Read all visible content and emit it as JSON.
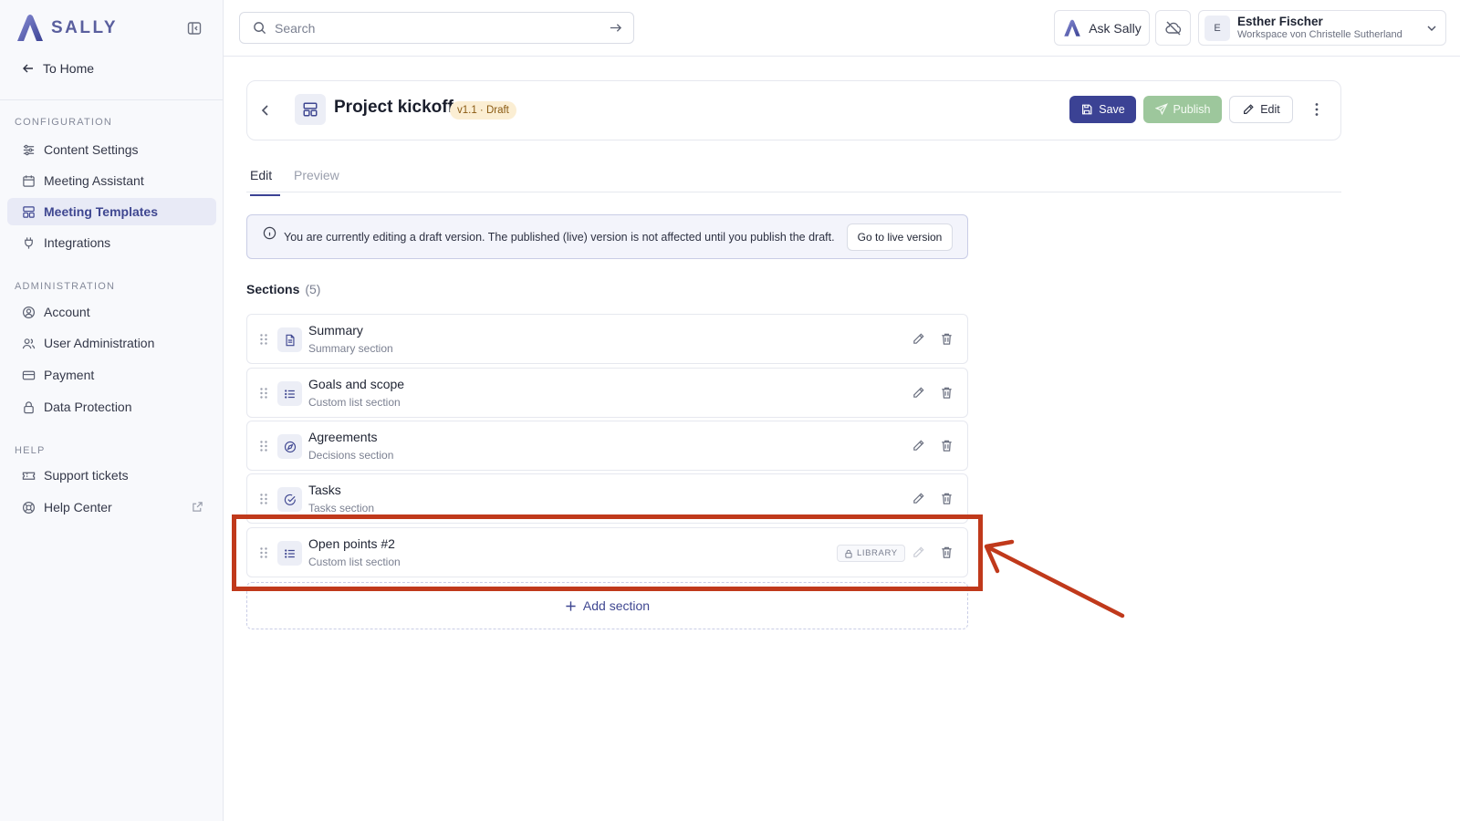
{
  "app": {
    "brand": "SALLY",
    "brand_color": "#5a5f9e",
    "accent_color": "#3b4294"
  },
  "sidebar": {
    "to_home": "To Home",
    "sections": [
      {
        "title": "CONFIGURATION",
        "items": [
          {
            "label": "Content Settings",
            "icon": "sliders-icon",
            "active": false
          },
          {
            "label": "Meeting Assistant",
            "icon": "calendar-icon",
            "active": false
          },
          {
            "label": "Meeting Templates",
            "icon": "layout-template-icon",
            "active": true
          },
          {
            "label": "Integrations",
            "icon": "plug-icon",
            "active": false
          }
        ]
      },
      {
        "title": "ADMINISTRATION",
        "items": [
          {
            "label": "Account",
            "icon": "user-circle-icon",
            "active": false
          },
          {
            "label": "User Administration",
            "icon": "users-icon",
            "active": false
          },
          {
            "label": "Payment",
            "icon": "credit-card-icon",
            "active": false
          },
          {
            "label": "Data Protection",
            "icon": "lock-icon",
            "active": false
          }
        ]
      },
      {
        "title": "HELP",
        "items": [
          {
            "label": "Support tickets",
            "icon": "ticket-icon",
            "active": false
          },
          {
            "label": "Help Center",
            "icon": "lifebuoy-icon",
            "active": false,
            "external": true
          }
        ]
      }
    ]
  },
  "topbar": {
    "search_placeholder": "Search",
    "ask_sally": "Ask Sally",
    "user": {
      "initial": "E",
      "name": "Esther Fischer",
      "workspace": "Workspace von Christelle Sutherland"
    }
  },
  "template": {
    "title": "Project kickoff",
    "badge": "v1.1 · Draft",
    "buttons": {
      "save": "Save",
      "publish": "Publish",
      "edit": "Edit"
    }
  },
  "tabs": {
    "edit": "Edit",
    "preview": "Preview",
    "active": "Edit"
  },
  "banner": {
    "text": "You are currently editing a draft version. The published (live) version is not affected until you publish the draft.",
    "button": "Go to live version"
  },
  "sections": {
    "heading": "Sections",
    "count": "(5)",
    "items": [
      {
        "title": "Summary",
        "subtitle": "Summary section",
        "icon": "document-icon",
        "library": false
      },
      {
        "title": "Goals and scope",
        "subtitle": "Custom list section",
        "icon": "list-icon",
        "library": false
      },
      {
        "title": "Agreements",
        "subtitle": "Decisions section",
        "icon": "compass-icon",
        "library": false
      },
      {
        "title": "Tasks",
        "subtitle": "Tasks section",
        "icon": "check-circle-icon",
        "library": false
      },
      {
        "title": "Open points #2",
        "subtitle": "Custom list section",
        "icon": "list-icon",
        "library": true,
        "library_label": "LIBRARY"
      }
    ],
    "add_label": "Add section"
  },
  "annotation": {
    "color": "#c0391b",
    "target": "Open points #2"
  }
}
